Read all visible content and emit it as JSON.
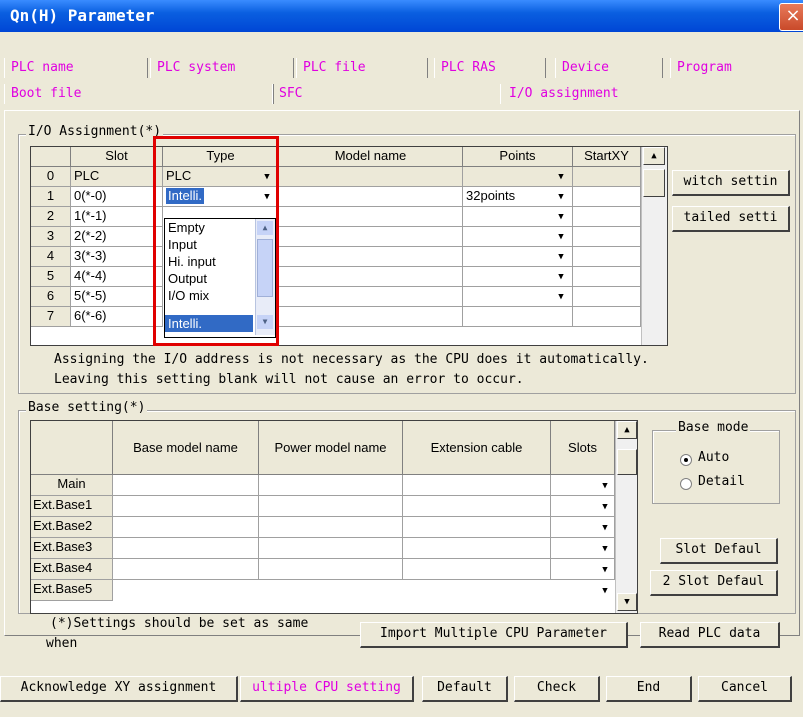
{
  "window": {
    "title": "Qn(H) Parameter",
    "close_glyph": "×"
  },
  "tabs_row1": [
    "PLC name",
    "PLC system",
    "PLC file",
    "PLC RAS",
    "Device",
    "Program"
  ],
  "tabs_row2": [
    "Boot file",
    "SFC",
    "I/O assignment"
  ],
  "io": {
    "group_title": "I/O Assignment(*)",
    "headers": [
      "Slot",
      "Type",
      "Model name",
      "Points",
      "StartXY"
    ],
    "rows": [
      {
        "num": "0",
        "slot": "PLC",
        "type": "PLC",
        "model": "",
        "points": "",
        "start": ""
      },
      {
        "num": "1",
        "slot": "0(*-0)",
        "type": "Intelli.",
        "model": "",
        "points": "32points",
        "start": ""
      },
      {
        "num": "2",
        "slot": "1(*-1)",
        "type": "",
        "model": "",
        "points": "",
        "start": ""
      },
      {
        "num": "3",
        "slot": "2(*-2)",
        "type": "",
        "model": "",
        "points": "",
        "start": ""
      },
      {
        "num": "4",
        "slot": "3(*-3)",
        "type": "",
        "model": "",
        "points": "",
        "start": ""
      },
      {
        "num": "5",
        "slot": "4(*-4)",
        "type": "",
        "model": "",
        "points": "",
        "start": ""
      },
      {
        "num": "6",
        "slot": "5(*-5)",
        "type": "",
        "model": "",
        "points": "",
        "start": ""
      },
      {
        "num": "7",
        "slot": "6(*-6)",
        "type": "",
        "model": "",
        "points": "",
        "start": ""
      }
    ],
    "dropdown_options": [
      "Empty",
      "Input",
      "Hi. input",
      "Output",
      "I/O mix",
      "Intelli."
    ],
    "dropdown_selected": "Intelli.",
    "switch_button": "witch settin",
    "detailed_button": "tailed setti",
    "note_line1": "Assigning the I/O address is not necessary as the CPU does it automatically.",
    "note_line2": "Leaving this setting blank will not cause an error to occur."
  },
  "base": {
    "group_title": "Base setting(*)",
    "headers": [
      "Base model name",
      "Power model name",
      "Extension cable",
      "Slots"
    ],
    "rows": [
      "Main",
      "Ext.Base1",
      "Ext.Base2",
      "Ext.Base3",
      "Ext.Base4",
      "Ext.Base5"
    ],
    "mode_title": "Base mode",
    "mode_auto": "Auto",
    "mode_detail": "Detail",
    "selected_mode": "Auto",
    "slot_default_1": "Slot Defaul",
    "slot_default_2": "2 Slot Defaul"
  },
  "footer": {
    "note_line1": "(*)Settings should be set as same",
    "note_line2": "when",
    "import_button": "Import Multiple CPU Parameter",
    "read_button": "Read PLC data"
  },
  "bottom_buttons": [
    "Acknowledge XY assignment",
    "ultiple CPU setting",
    "Default",
    "Check",
    "End",
    "Cancel"
  ],
  "colors": {
    "tab_text": "#e000e0",
    "selection": "#316ac5",
    "highlight_box": "#e00000",
    "titlebar": "#0a5fe0"
  },
  "icons": {
    "close": "close-icon",
    "dropdown": "chevron-down-icon",
    "scroll_up": "arrow-up-icon",
    "scroll_down": "arrow-down-icon"
  }
}
